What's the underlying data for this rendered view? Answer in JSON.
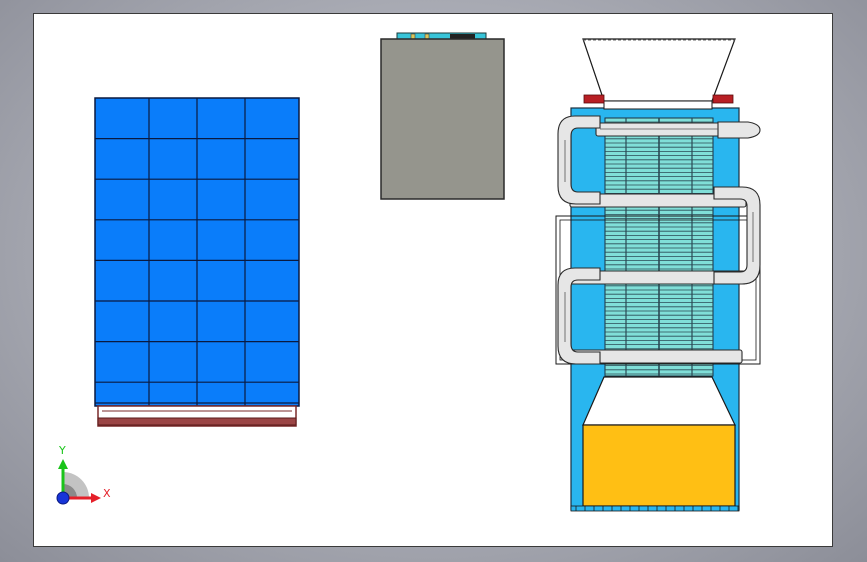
{
  "viewport": {
    "background": "#a9abb4",
    "sheet_background": "#ffffff"
  },
  "parts": {
    "panel_array": {
      "fill": "#0a7dfa",
      "rows": 8,
      "columns": 4,
      "base_color": "#7a2a2a"
    },
    "enclosure": {
      "fill": "#95958d",
      "top_strip": "#38c4d8"
    },
    "exchanger": {
      "hopper_fill": "#ffffff",
      "body_fill": "#29b6ef",
      "fins_fill": "#80dfd8",
      "pipe_fill": "#e6e6e6",
      "tank_fill": "#ffbf14",
      "flange_fill": "#b81f24"
    }
  },
  "triad": {
    "x_label": "X",
    "y_label": "Y",
    "x_color": "#e5202a",
    "y_color": "#19c419",
    "z_color": "#1734d8"
  }
}
